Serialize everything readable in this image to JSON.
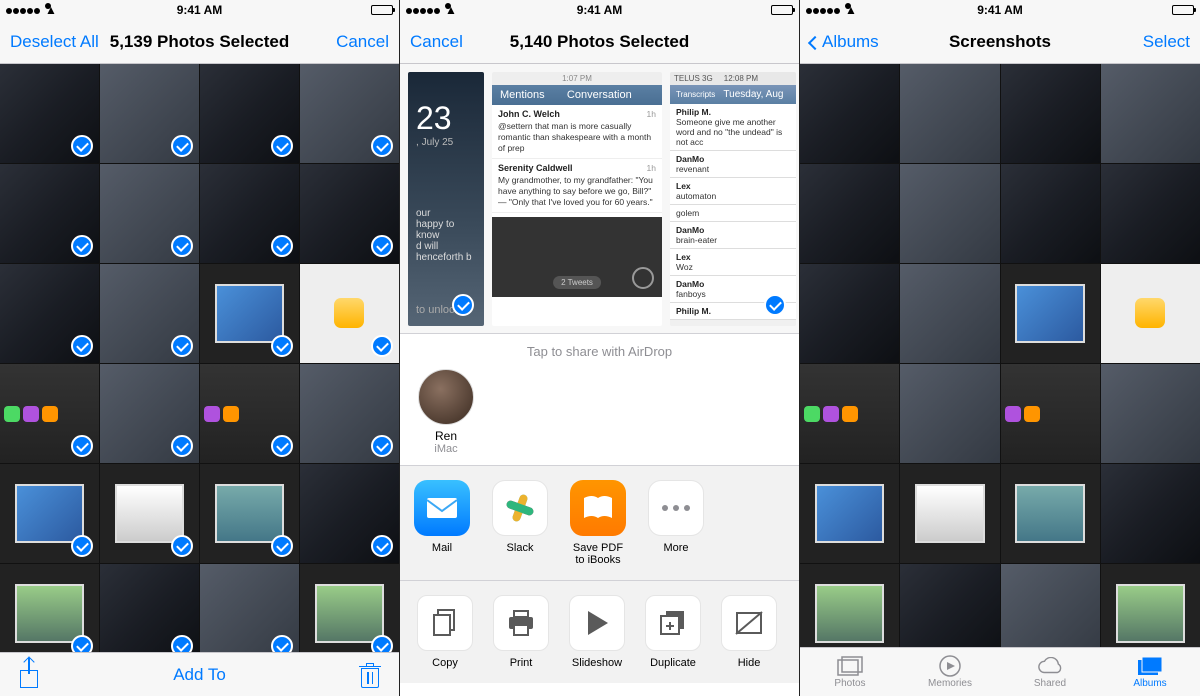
{
  "status": {
    "time": "9:41 AM"
  },
  "phone1": {
    "deselect": "Deselect All",
    "title": "5,139 Photos Selected",
    "cancel": "Cancel",
    "addTo": "Add To"
  },
  "phone2": {
    "cancel": "Cancel",
    "title": "5,140 Photos Selected",
    "airdropHint": "Tap to share with AirDrop",
    "contact": {
      "name": "Ren",
      "sub": "iMac"
    },
    "apps": [
      {
        "label": "Mail"
      },
      {
        "label": "Slack"
      },
      {
        "label": "Save PDF to iBooks"
      },
      {
        "label": "More"
      }
    ],
    "actions": [
      {
        "label": "Copy"
      },
      {
        "label": "Print"
      },
      {
        "label": "Slideshow"
      },
      {
        "label": "Duplicate"
      },
      {
        "label": "Hide"
      }
    ],
    "thumb1": {
      "day": "23",
      "date": "July 25",
      "hint1": "happy to know",
      "hint2": "will henceforth",
      "unlock": "to unlock"
    },
    "thumb2": {
      "headerTab1": "Mentions",
      "headerTitle": "Conversation",
      "rows": [
        {
          "n": "John C. Welch",
          "t": "@settern that man is more casually romantic than shakespeare with a month of prep"
        },
        {
          "n": "Serenity Caldwell",
          "t": "My grandmother, to my grandfather: \"You have anything to say before we go, Bill?\" — \"Only that I've loved you for 60 years.\""
        }
      ],
      "tweetcount": "2 Tweets"
    },
    "thumb3": {
      "header": "Tuesday, Aug",
      "tab": "Transcripts",
      "items": [
        {
          "n": "Philip M.",
          "t": "Someone give me another word and no \"the undead\" is not acc"
        },
        {
          "n": "DanMo",
          "t": "revenant"
        },
        {
          "n": "Lex",
          "t": "automaton"
        },
        {
          "n": "",
          "t": "golem"
        },
        {
          "n": "DanMo",
          "t": "brain-eater"
        },
        {
          "n": "Lex",
          "t": "Woz"
        },
        {
          "n": "DanMo",
          "t": "fanboys"
        },
        {
          "n": "Philip M.",
          "t": ""
        }
      ]
    }
  },
  "phone3": {
    "back": "Albums",
    "title": "Screenshots",
    "select": "Select",
    "tabs": [
      "Photos",
      "Memories",
      "Shared",
      "Albums"
    ]
  }
}
